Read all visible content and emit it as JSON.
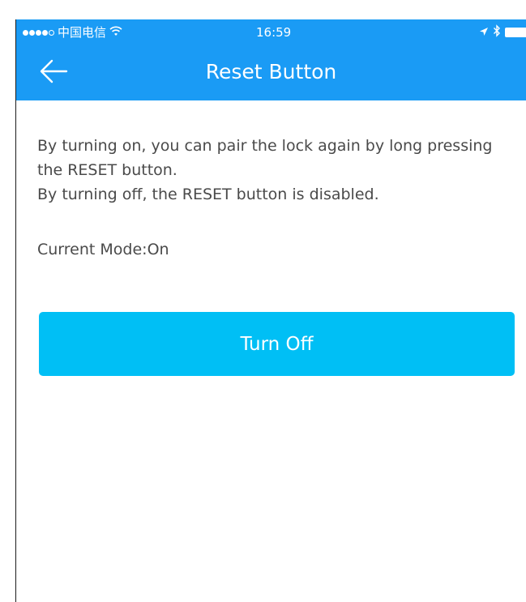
{
  "status_bar": {
    "carrier": "中国电信",
    "time": "16:59",
    "signal_bars_filled": 4,
    "signal_bars_total": 5
  },
  "nav": {
    "title": "Reset Button",
    "back_icon": "arrow-left-icon"
  },
  "content": {
    "description_line1": "By turning on, you can pair the lock again by long pressing the RESET button.",
    "description_line2": " By turning off, the RESET button is disabled.",
    "mode_label": "Current Mode:",
    "mode_value": "On"
  },
  "action": {
    "button_label": "Turn Off"
  },
  "colors": {
    "nav_bar": "#1a9bf5",
    "button": "#00bff5",
    "body_text": "#4a4a4a"
  }
}
